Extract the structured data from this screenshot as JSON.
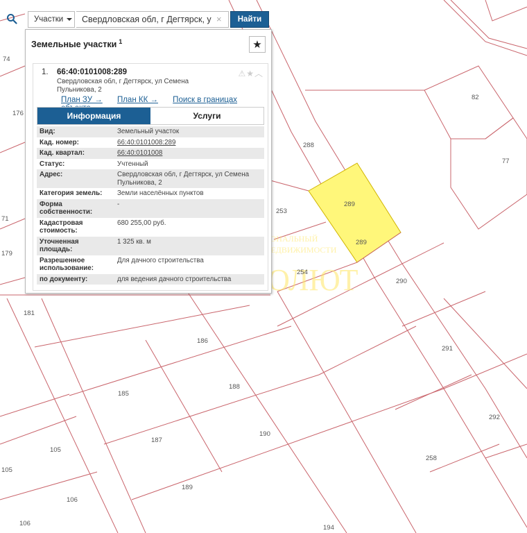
{
  "map": {
    "plots": [
      "74",
      "176",
      "71",
      "179",
      "181",
      "186",
      "185",
      "188",
      "187",
      "190",
      "189",
      "105",
      "105",
      "106",
      "106",
      "194",
      "288",
      "289",
      "289",
      "253",
      "254",
      "290",
      "291",
      "292",
      "258",
      "82",
      "77"
    ],
    "highlighted_plot": "289",
    "watermark": {
      "line1": "РЕГИОНАЛЬНЫЙ",
      "line2": "ЦЕНТР НЕДВИЖИМОСТИ",
      "brand": "АБСОЛЮТ"
    },
    "colors": {
      "boundary": "#c9646b",
      "highlight": "#fff77a",
      "accent": "#1c5f94"
    }
  },
  "search": {
    "type_label": "Участки",
    "query": "Свердловская обл, г Дегтярск, у",
    "button": "Найти"
  },
  "panel": {
    "title": "Земельные участки",
    "count": "1",
    "result": {
      "number": "1.",
      "cadastral": "66:40:0101008:289",
      "address": "Свердловская обл, г Дегтярск, ул Семена Пульникова, 2",
      "links": [
        "План ЗУ →",
        "План КК →",
        "Поиск в границах объекта →"
      ]
    },
    "tabs": [
      "Информация",
      "Услуги"
    ],
    "info": [
      {
        "key": "Вид:",
        "value": "Земельный участок"
      },
      {
        "key": "Кад. номер:",
        "value": "66:40:0101008:289"
      },
      {
        "key": "Кад. квартал:",
        "value": "66:40:0101008"
      },
      {
        "key": "Статус:",
        "value": "Учтенный"
      },
      {
        "key": "Адрес:",
        "value": "Свердловская обл, г Дегтярск, ул Семена Пульникова, 2"
      },
      {
        "key": "Категория земель:",
        "value": "Земли населённых пунктов"
      },
      {
        "key": "Форма собственности:",
        "value": "-"
      },
      {
        "key": "Кадастровая стоимость:",
        "value": "680 255,00 руб."
      },
      {
        "key": "Уточненная площадь:",
        "value": "1 325 кв. м"
      },
      {
        "key": "Разрешенное использование:",
        "value": "Для дачного строительства"
      },
      {
        "key": "по документу:",
        "value": "для ведения дачного строительства"
      }
    ]
  }
}
